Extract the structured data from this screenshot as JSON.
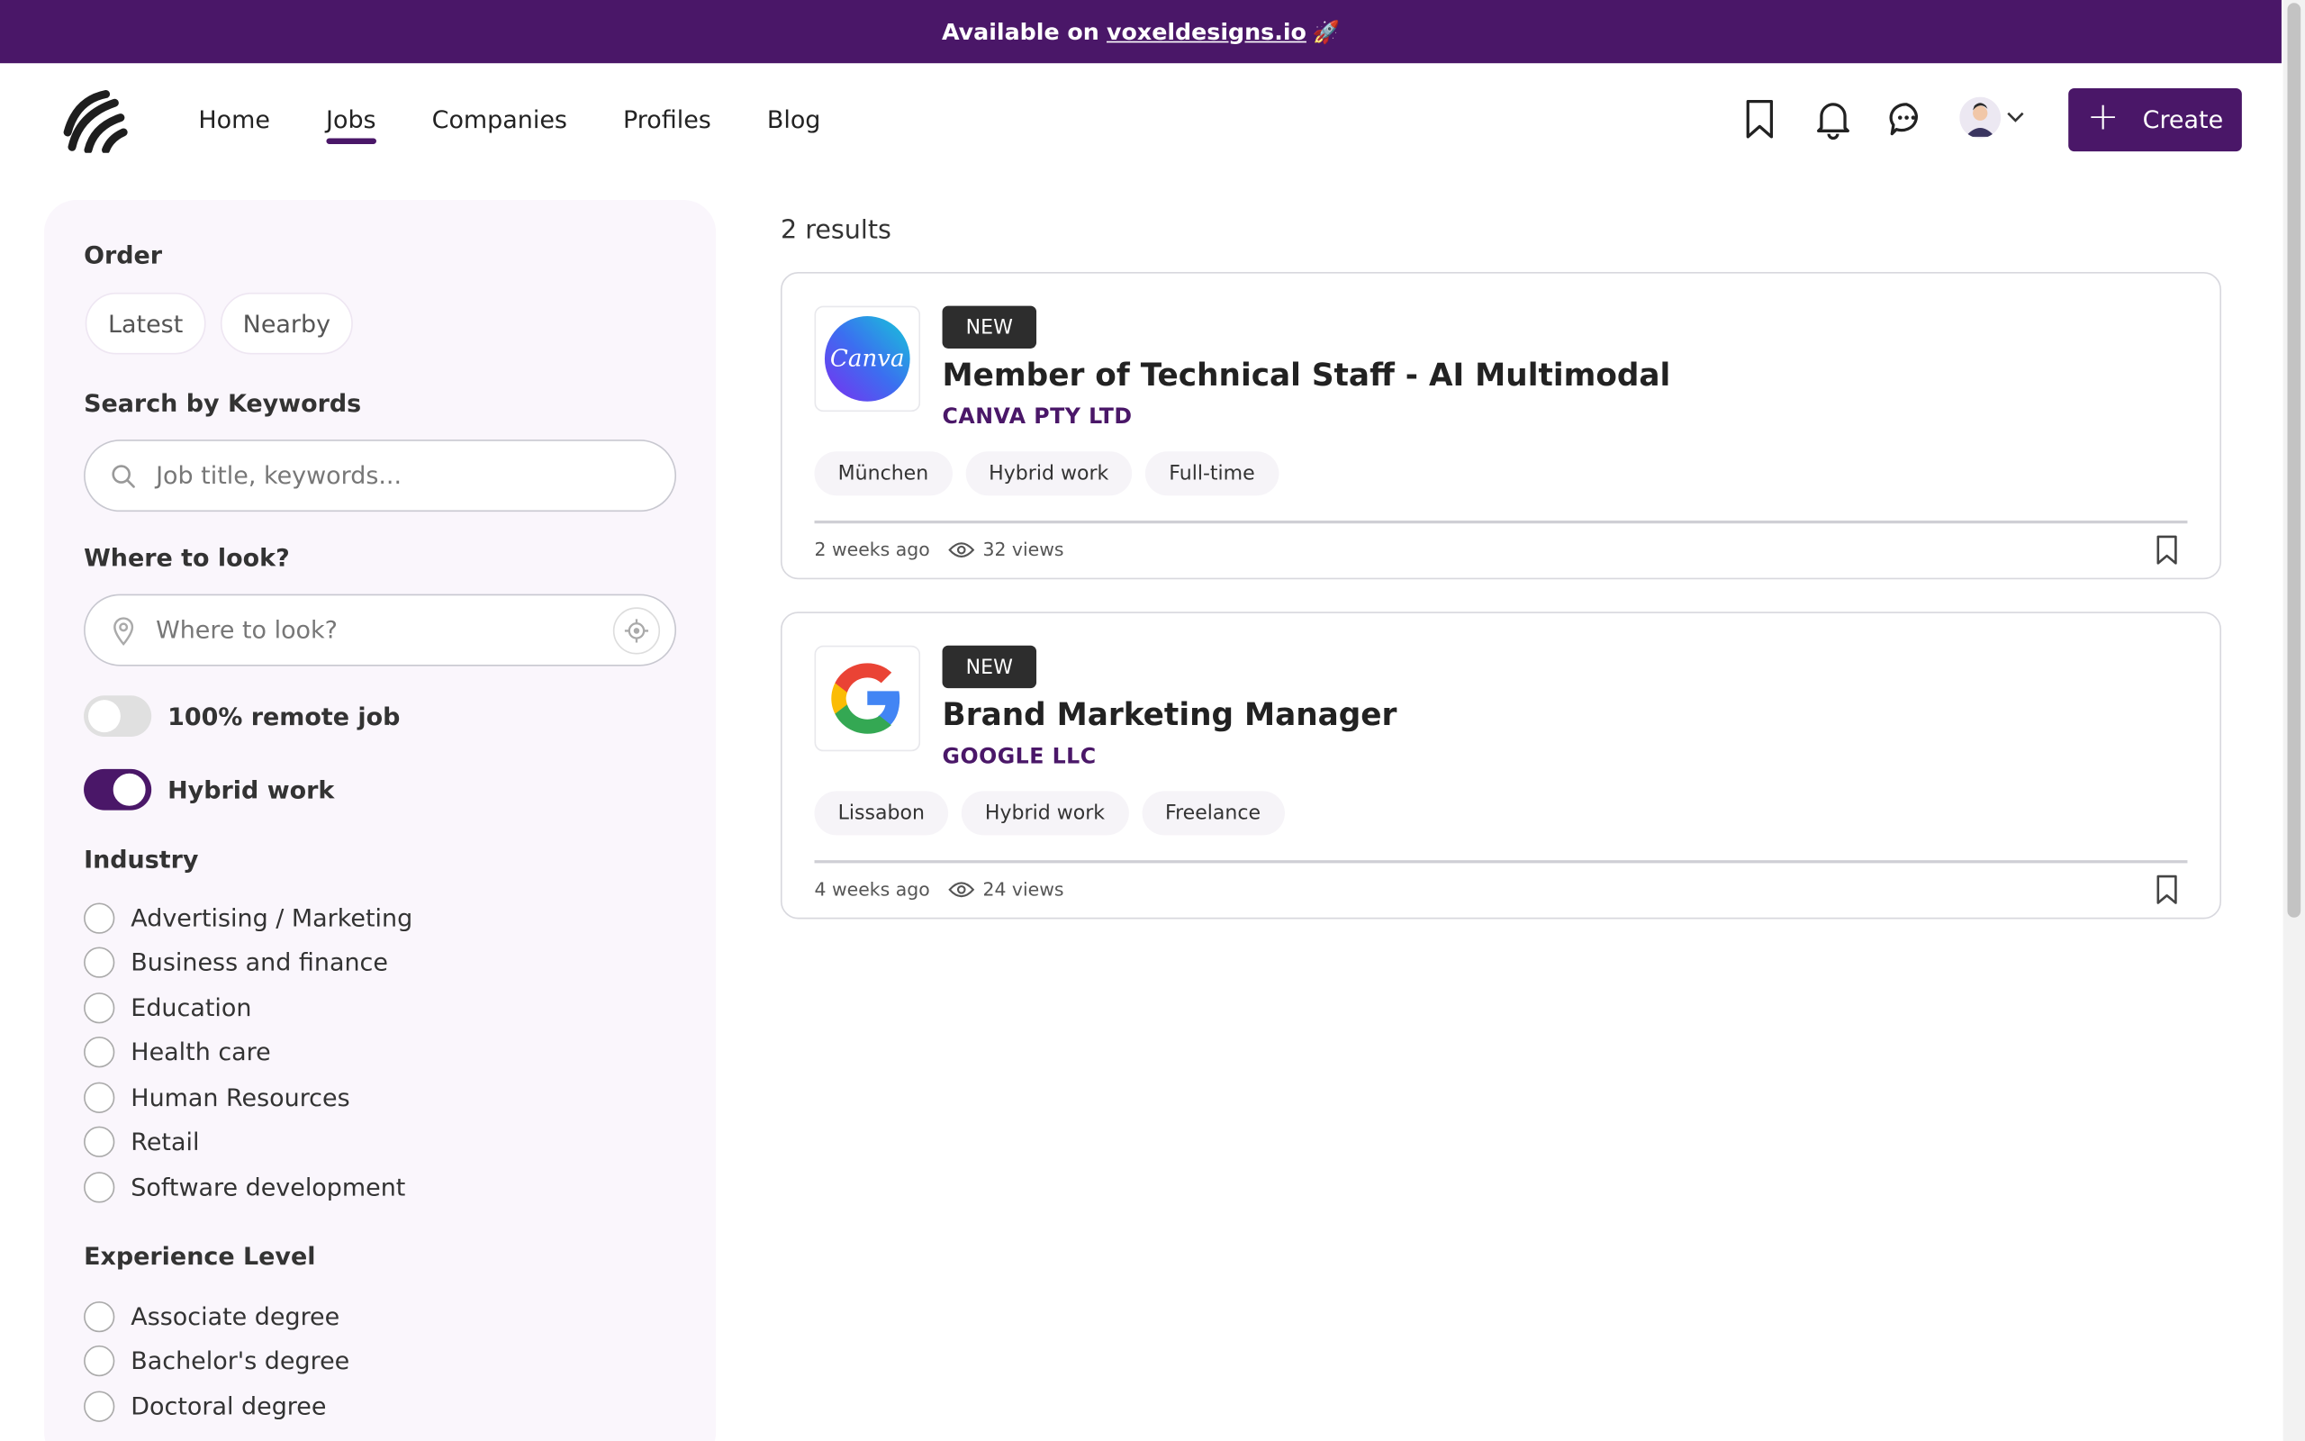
{
  "banner": {
    "text": "Available on",
    "link": "voxeldesigns.io",
    "emoji": "🚀"
  },
  "nav": {
    "items": [
      "Home",
      "Jobs",
      "Companies",
      "Profiles",
      "Blog"
    ],
    "active": "Jobs"
  },
  "header": {
    "create_label": "Create"
  },
  "colors": {
    "brand": "#4a1768",
    "badge": "#2d2d2d"
  },
  "filters": {
    "order_title": "Order",
    "order_options": [
      "Latest",
      "Nearby"
    ],
    "keywords_title": "Search by Keywords",
    "keywords_placeholder": "Job title, keywords...",
    "location_title": "Where to look?",
    "location_placeholder": "Where to look?",
    "remote_label": "100% remote job",
    "remote_on": false,
    "hybrid_label": "Hybrid work",
    "hybrid_on": true,
    "industry_title": "Industry",
    "industries": [
      "Advertising / Marketing",
      "Business and finance",
      "Education",
      "Health care",
      "Human Resources",
      "Retail",
      "Software development"
    ],
    "experience_title": "Experience Level",
    "experience": [
      "Associate degree",
      "Bachelor's degree",
      "Doctoral degree"
    ]
  },
  "results": {
    "count_label": "2 results",
    "jobs": [
      {
        "badge": "NEW",
        "title": "Member of Technical Staff - AI Multimodal",
        "company": "CANVA PTY LTD",
        "logo": "Canva",
        "tags": [
          "München",
          "Hybrid work",
          "Full-time"
        ],
        "posted": "2 weeks ago",
        "views": "32 views"
      },
      {
        "badge": "NEW",
        "title": "Brand Marketing Manager",
        "company": "GOOGLE LLC",
        "logo": "google-logo",
        "tags": [
          "Lissabon",
          "Hybrid work",
          "Freelance"
        ],
        "posted": "4 weeks ago",
        "views": "24 views"
      }
    ]
  }
}
